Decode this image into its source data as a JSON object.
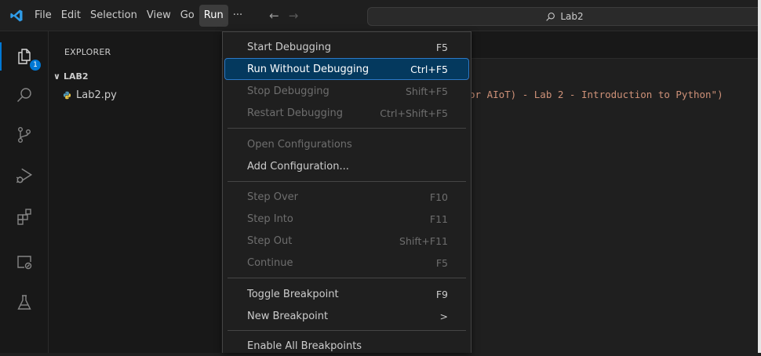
{
  "titlebar": {
    "menus": [
      "File",
      "Edit",
      "Selection",
      "View",
      "Go",
      "Run",
      "···"
    ],
    "active_menu": "Run",
    "search_text": "Lab2",
    "back_arrow": "←",
    "forward_arrow": "→"
  },
  "activity": {
    "explorer_badge": "1"
  },
  "sidebar": {
    "title": "EXPLORER",
    "folder": "LAB2",
    "folder_chevron": "∨",
    "file": "Lab2.py"
  },
  "editor": {
    "code_fragment": "or AIoT) - Lab 2 - Introduction to Python\")"
  },
  "run_menu": {
    "start_debugging": {
      "label": "Start Debugging",
      "key": "F5"
    },
    "run_without_debugging": {
      "label": "Run Without Debugging",
      "key": "Ctrl+F5"
    },
    "stop_debugging": {
      "label": "Stop Debugging",
      "key": "Shift+F5"
    },
    "restart_debugging": {
      "label": "Restart Debugging",
      "key": "Ctrl+Shift+F5"
    },
    "open_configurations": {
      "label": "Open Configurations"
    },
    "add_configuration": {
      "label": "Add Configuration..."
    },
    "step_over": {
      "label": "Step Over",
      "key": "F10"
    },
    "step_into": {
      "label": "Step Into",
      "key": "F11"
    },
    "step_out": {
      "label": "Step Out",
      "key": "Shift+F11"
    },
    "continue": {
      "label": "Continue",
      "key": "F5"
    },
    "toggle_breakpoint": {
      "label": "Toggle Breakpoint",
      "key": "F9"
    },
    "new_breakpoint": {
      "label": "New Breakpoint",
      "key": ">"
    },
    "enable_all_breakpoints": {
      "label": "Enable All Breakpoints"
    }
  },
  "colors": {
    "accent": "#0078d4",
    "highlight": "#04395e",
    "string": "#ce9178"
  }
}
